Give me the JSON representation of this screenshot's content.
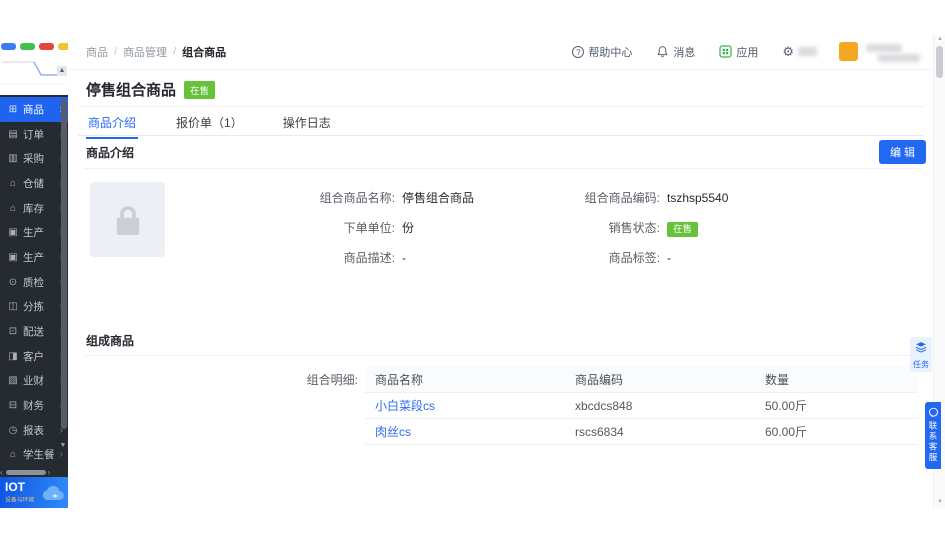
{
  "breadcrumb": [
    "商品",
    "商品管理",
    "组合商品"
  ],
  "header": {
    "help_label": "帮助中心",
    "messages_label": "消息",
    "apps_label": "应用"
  },
  "sidebar": {
    "items": [
      {
        "label": "商品",
        "icon": "goods",
        "active": true
      },
      {
        "label": "订单",
        "icon": "orders"
      },
      {
        "label": "采购",
        "icon": "purchase"
      },
      {
        "label": "仓储",
        "icon": "warehouse"
      },
      {
        "label": "库存",
        "icon": "inventory"
      },
      {
        "label": "生产",
        "icon": "production"
      },
      {
        "label": "生产",
        "icon": "production"
      },
      {
        "label": "质检",
        "icon": "quality-check"
      },
      {
        "label": "分拣",
        "icon": "sorting"
      },
      {
        "label": "配送",
        "icon": "delivery"
      },
      {
        "label": "客户",
        "icon": "customers"
      },
      {
        "label": "业财",
        "icon": "business-finance"
      },
      {
        "label": "财务",
        "icon": "finance"
      },
      {
        "label": "报表",
        "icon": "reports"
      },
      {
        "label": "学生餐",
        "icon": "student-meal"
      }
    ],
    "iot": {
      "title": "IOT",
      "subtitle": "设备与环境"
    }
  },
  "page": {
    "title": "停售组合商品",
    "status_badge": "在售",
    "tabs": [
      {
        "label": "商品介绍",
        "active": true
      },
      {
        "label": "报价单（1）"
      },
      {
        "label": "操作日志"
      }
    ],
    "edit_button": "编 辑",
    "intro": {
      "title": "商品介绍",
      "fields_left": [
        {
          "label": "组合商品名称:",
          "value": "停售组合商品"
        },
        {
          "label": "下单单位:",
          "value": "份"
        },
        {
          "label": "商品描述:",
          "value": "-"
        }
      ],
      "fields_right": [
        {
          "label": "组合商品编码:",
          "value": "tszhsp5540"
        },
        {
          "label": "销售状态:",
          "value": "在售",
          "badge": true
        },
        {
          "label": "商品标签:",
          "value": "-"
        }
      ]
    },
    "components": {
      "title": "组成商品",
      "detail_label": "组合明细:",
      "table": {
        "columns": [
          "商品名称",
          "商品编码",
          "数量"
        ],
        "rows": [
          {
            "name": "小白菜段cs",
            "code": "xbcdcs848",
            "qty": "50.00斤"
          },
          {
            "name": "肉丝cs",
            "code": "rscs6834",
            "qty": "60.00斤"
          }
        ]
      }
    }
  },
  "floating": {
    "task": "任务",
    "service": "联系客服"
  },
  "colors": {
    "accent": "#2268f2",
    "status_green": "#67c23a",
    "avatar_orange": "#f5a623"
  }
}
